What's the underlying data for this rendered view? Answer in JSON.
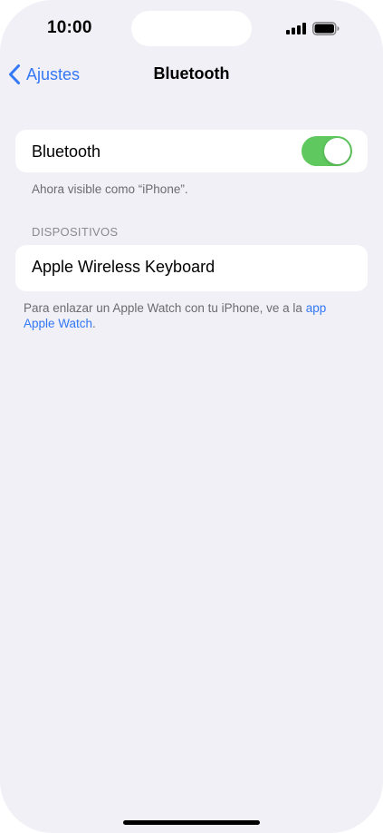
{
  "status_bar": {
    "time": "10:00",
    "signal_icon": "cellular-signal-icon",
    "battery_icon": "battery-full-icon"
  },
  "nav": {
    "back_label": "Ajustes",
    "back_icon": "chevron-left-icon",
    "title": "Bluetooth"
  },
  "bluetooth": {
    "label": "Bluetooth",
    "toggle_on": true,
    "toggle_color": "#5fc85e",
    "visibility_note": "Ahora visible como “iPhone”."
  },
  "devices": {
    "header": "DISPOSITIVOS",
    "items": [
      {
        "name": "Apple Wireless Keyboard"
      }
    ]
  },
  "footer": {
    "text": "Para enlazar un Apple Watch con tu iPhone, ve a la ",
    "link": "app Apple Watch",
    "end": "."
  },
  "colors": {
    "accent": "#3478f6",
    "background": "#f0f0f6"
  }
}
